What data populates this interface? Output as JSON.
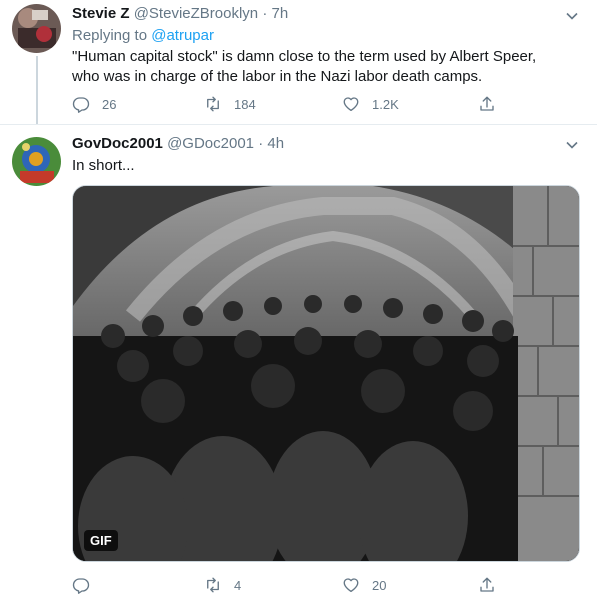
{
  "tweets": [
    {
      "display_name": "Stevie Z",
      "handle": "@StevieZBrooklyn",
      "separator": "·",
      "time": "7h",
      "reply_prefix": "Replying to",
      "reply_to": "@atrupar",
      "text_line1": "\"Human capital stock\" is damn close to the term used by Albert Speer,",
      "text_line2": "who was in charge of the labor in the Nazi labor death camps.",
      "replies": "26",
      "retweets": "184",
      "likes": "1.2K"
    },
    {
      "display_name": "GovDoc2001",
      "handle": "@GDoc2001",
      "separator": "·",
      "time": "4h",
      "text": "In short...",
      "media_badge": "GIF",
      "replies": "",
      "retweets": "4",
      "likes": "20"
    }
  ],
  "icons": {
    "reply": "reply-icon",
    "retweet": "retweet-icon",
    "like": "heart-icon",
    "share": "share-icon",
    "more": "chevron-down-icon"
  },
  "colors": {
    "link": "#1da1f2",
    "secondary_text": "#657786",
    "primary_text": "#14171a"
  }
}
